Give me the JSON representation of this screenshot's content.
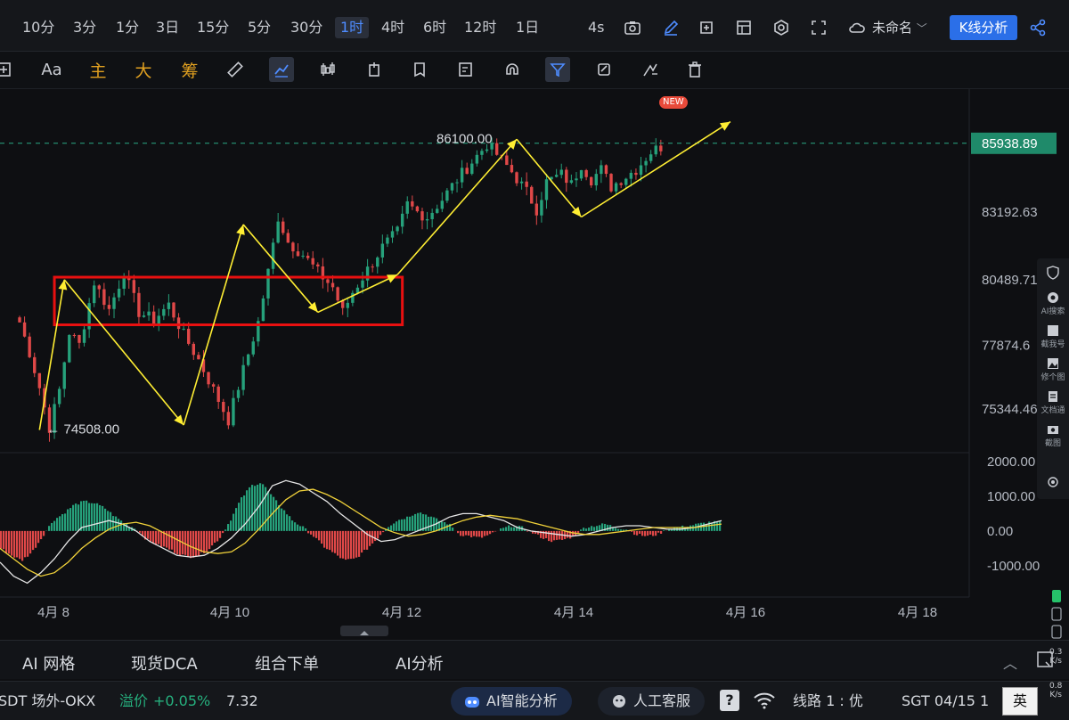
{
  "timeframes": [
    "10分",
    "3分",
    "1分",
    "3日",
    "15分",
    "5分",
    "30分",
    "1时",
    "4时",
    "6时",
    "12时",
    "1日"
  ],
  "active_timeframe": "1时",
  "refresh": "4s",
  "doc_name": "未命名",
  "kline_button": "K线分析",
  "toolbar": {
    "font_label": "Aa",
    "main_label": "主",
    "big_label": "大",
    "chip_label": "筹",
    "new_badge": "NEW"
  },
  "right_rail": [
    "AI搜索",
    "截我号",
    "修个图",
    "文档通",
    "截图"
  ],
  "bottom_tabs": [
    "AI 网格",
    "现货DCA",
    "组合下单",
    "AI分析"
  ],
  "status": {
    "pair": "SDT 场外-OKX",
    "premium_label": "溢价",
    "premium_value": "+0.05%",
    "premium_price": "7.32",
    "ai_pill": "AI智能分析",
    "service_pill": "人工客服",
    "line_label": "线路 1 : 优",
    "timezone": "SGT 04/15 1",
    "lang": "英",
    "net_up": "0.3",
    "net_down": "0.8",
    "net_unit": "K/s"
  },
  "colors": {
    "up": "#26a17b",
    "down": "#e04848",
    "accent": "#2b6fe8",
    "annot_yellow": "#ffee33",
    "box_red": "#e81010",
    "last_price_bg": "#1f8a6a"
  },
  "chart_data": {
    "type": "candlestick",
    "price_axis_labels": [
      "83192.63",
      "80489.71",
      "77874.6",
      "75344.46"
    ],
    "price_ylim": [
      73600,
      88100
    ],
    "last_price": "85938.89",
    "last_price_value": 85938.89,
    "high_label": "86100.00",
    "high_value": 86100,
    "low_label": "← 74508.00",
    "low_value": 74508,
    "date_labels": [
      "4月 8",
      "4月 10",
      "4月 12",
      "4月 14",
      "4月 16",
      "4月 18"
    ],
    "price_path": [
      [
        0,
        78800
      ],
      [
        2,
        77600
      ],
      [
        4,
        76200
      ],
      [
        6,
        74600
      ],
      [
        8,
        76100
      ],
      [
        10,
        78400
      ],
      [
        12,
        77900
      ],
      [
        15,
        80400
      ],
      [
        18,
        79300
      ],
      [
        21,
        80800
      ],
      [
        24,
        79200
      ],
      [
        27,
        78900
      ],
      [
        30,
        79500
      ],
      [
        33,
        78300
      ],
      [
        36,
        77300
      ],
      [
        39,
        76100
      ],
      [
        42,
        74900
      ],
      [
        45,
        76900
      ],
      [
        48,
        78800
      ],
      [
        50,
        80800
      ],
      [
        52,
        83000
      ],
      [
        54,
        82000
      ],
      [
        57,
        81500
      ],
      [
        60,
        80800
      ],
      [
        63,
        80200
      ],
      [
        65,
        79200
      ],
      [
        67,
        80000
      ],
      [
        70,
        80900
      ],
      [
        73,
        81800
      ],
      [
        76,
        82400
      ],
      [
        78,
        83500
      ],
      [
        80,
        83200
      ],
      [
        82,
        83000
      ],
      [
        85,
        83700
      ],
      [
        88,
        84500
      ],
      [
        91,
        85200
      ],
      [
        94,
        85900
      ],
      [
        96,
        85500
      ],
      [
        99,
        84800
      ],
      [
        102,
        84000
      ],
      [
        104,
        83300
      ],
      [
        106,
        84400
      ],
      [
        109,
        84700
      ],
      [
        111,
        84300
      ],
      [
        113,
        85100
      ],
      [
        115,
        84500
      ],
      [
        117,
        84900
      ],
      [
        119,
        84200
      ],
      [
        121,
        84500
      ],
      [
        124,
        84900
      ],
      [
        127,
        85600
      ],
      [
        129,
        85800
      ]
    ],
    "macd": {
      "axis_labels": [
        "2000.00",
        "1000.00",
        "0.00",
        "-1000.00"
      ],
      "ylim": [
        -1900,
        2150
      ],
      "hist": [
        -500,
        -700,
        -850,
        -600,
        -150,
        300,
        500,
        750,
        850,
        800,
        650,
        400,
        200,
        50,
        -250,
        -400,
        -500,
        -650,
        -750,
        -700,
        -500,
        -200,
        300,
        900,
        1300,
        1400,
        1000,
        650,
        300,
        100,
        -150,
        -450,
        -650,
        -850,
        -800,
        -550,
        -250,
        100,
        300,
        400,
        550,
        450,
        300,
        200,
        -100,
        -150,
        -200,
        -100,
        50,
        150,
        100,
        -50,
        -200,
        -300,
        -250,
        -150,
        100,
        150,
        200,
        100,
        50,
        -100,
        -150,
        -100,
        50,
        100,
        150,
        200,
        250,
        250
      ],
      "dif": [
        -900,
        -1300,
        -1500,
        -1200,
        -800,
        -300,
        100,
        200,
        300,
        200,
        0,
        -300,
        -500,
        -700,
        -750,
        -700,
        -500,
        -200,
        200,
        700,
        1300,
        1450,
        1350,
        1100,
        850,
        500,
        200,
        -100,
        -300,
        -250,
        -100,
        50,
        200,
        400,
        500,
        500,
        400,
        300,
        100,
        0,
        -50,
        -100,
        -150,
        -100,
        0,
        100,
        150,
        150,
        100,
        50,
        50,
        100,
        200,
        300
      ],
      "dea": [
        -500,
        -800,
        -1100,
        -1300,
        -1200,
        -900,
        -500,
        -200,
        50,
        200,
        250,
        150,
        -50,
        -250,
        -450,
        -600,
        -650,
        -600,
        -350,
        50,
        500,
        900,
        1150,
        1200,
        1050,
        850,
        600,
        350,
        100,
        -50,
        -150,
        -100,
        0,
        150,
        300,
        400,
        450,
        400,
        350,
        250,
        150,
        50,
        -50,
        -100,
        -100,
        -50,
        0,
        50,
        100,
        100,
        100,
        100,
        150,
        200
      ]
    },
    "annotations": {
      "zigzag_1": [
        [
          4,
          74508
        ],
        [
          9,
          80500
        ],
        [
          33,
          74700
        ],
        [
          45,
          82700
        ],
        [
          60,
          79200
        ],
        [
          76,
          80700
        ],
        [
          100,
          86100
        ],
        [
          113,
          83000
        ],
        [
          143,
          86800
        ]
      ],
      "box": {
        "x0": 7,
        "x1": 77,
        "y0": 80600,
        "y1": 78700
      }
    }
  }
}
